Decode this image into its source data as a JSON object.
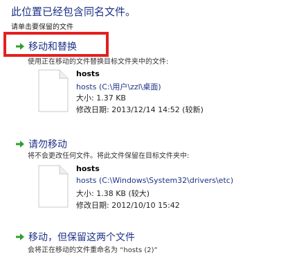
{
  "dialog": {
    "title": "此位置已经包含同名文件。",
    "subtitle": "请单击要保留的文件"
  },
  "options": [
    {
      "label": "移动和替换",
      "desc": "使用正在移动的文件替换目标文件夹中的文件:",
      "file": {
        "name": "hosts",
        "path": "hosts (C:\\用户\\zzl\\桌面)",
        "size": "大小: 1.37 KB",
        "modified": "修改日期: 2013/12/14 14:52 (较新)"
      }
    },
    {
      "label": "请勿移动",
      "desc": "将不会更改任何文件。将此文件保留在目标文件夹中:",
      "file": {
        "name": "hosts",
        "path": "hosts (C:\\Windows\\System32\\drivers\\etc)",
        "size": "大小: 1.38 KB (较大)",
        "modified": "修改日期: 2012/10/10 15:42"
      }
    },
    {
      "label": "移动，但保留这两个文件",
      "desc": "会将正在移动的文件重命名为 “hosts (2)”"
    }
  ],
  "colors": {
    "accent": "#1e3287",
    "arrow": "#2e9e2e",
    "highlight": "#e61e1e"
  },
  "icons": {
    "option_arrow": "green-right-arrow-icon",
    "file": "blank-file-icon"
  }
}
